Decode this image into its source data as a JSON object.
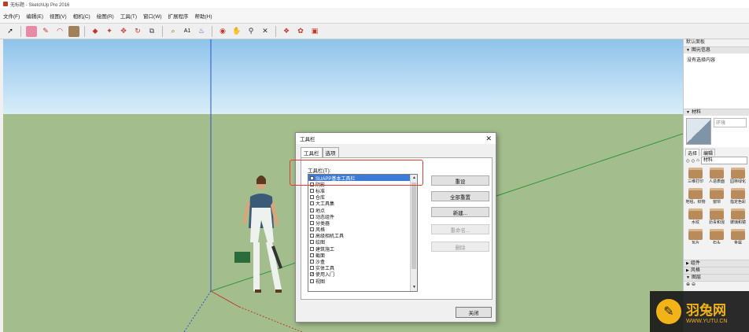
{
  "window": {
    "title": "无标题 - SketchUp Pro 2016"
  },
  "menu": [
    "文件(F)",
    "编辑(E)",
    "视图(V)",
    "相机(C)",
    "绘图(R)",
    "工具(T)",
    "窗口(W)",
    "扩展程序",
    "帮助(H)"
  ],
  "tray": {
    "title": "默认面板",
    "entity_info": {
      "label": "图元信息",
      "text": "没有选择内容"
    },
    "materials": {
      "label": "材料",
      "name_placeholder": "环境",
      "tabs": [
        "选择",
        "编辑"
      ],
      "collection": "材料",
      "items": [
        "三维打印",
        "人造表面",
        "园林绿化",
        "地毯，织物",
        "窗帘",
        "指定色彩",
        "水纹",
        "沥青和混",
        "玻璃和镜",
        "瓦片",
        "石头",
        "金属"
      ]
    },
    "sections": [
      "组件",
      "风格",
      "图层"
    ]
  },
  "dialog": {
    "title": "工具栏",
    "tabs": [
      "工具栏",
      "选项"
    ],
    "list_label": "工具栏(T):",
    "items": [
      {
        "label": "SUAPP基本工具栏",
        "checked": false,
        "selected": true
      },
      {
        "label": "阴影",
        "checked": false
      },
      {
        "label": "标准",
        "checked": false
      },
      {
        "label": "仓库",
        "checked": false
      },
      {
        "label": "大工具集",
        "checked": false
      },
      {
        "label": "地点",
        "checked": false
      },
      {
        "label": "动态组件",
        "checked": false
      },
      {
        "label": "分类器",
        "checked": false
      },
      {
        "label": "风格",
        "checked": false
      },
      {
        "label": "高级相机工具",
        "checked": false
      },
      {
        "label": "绘图",
        "checked": false
      },
      {
        "label": "建筑施工",
        "checked": false
      },
      {
        "label": "截面",
        "checked": false
      },
      {
        "label": "沙盒",
        "checked": false
      },
      {
        "label": "实体工具",
        "checked": false
      },
      {
        "label": "使用入门",
        "checked": true
      },
      {
        "label": "视图",
        "checked": false
      }
    ],
    "buttons": {
      "reset": "重设",
      "reset_all": "全部重置",
      "new": "新建...",
      "rename": "重命名...",
      "delete": "删除"
    },
    "close": "关闭"
  },
  "watermark": {
    "name": "羽兔网",
    "url": "WWW.YUTU.CN",
    "logo_glyph": "✎"
  },
  "colors": {
    "sky_top": "#8fc3ea",
    "ground": "#a3bd8d",
    "selection": "#3d7ad6",
    "highlight": "#e53935",
    "watermark": "#f2b318"
  },
  "toolbar_icons": [
    "select-icon",
    "eraser-icon",
    "pencil-icon",
    "arc-icon",
    "shape-icon",
    "push-pull-icon",
    "follow-me-icon",
    "move-icon",
    "rotate-icon",
    "scale-icon",
    "tape-icon",
    "text-icon",
    "paint-icon",
    "orbit-icon",
    "pan-icon",
    "zoom-icon",
    "zoom-extents-icon",
    "warehouse-icon",
    "extension-icon",
    "model-info-icon"
  ]
}
